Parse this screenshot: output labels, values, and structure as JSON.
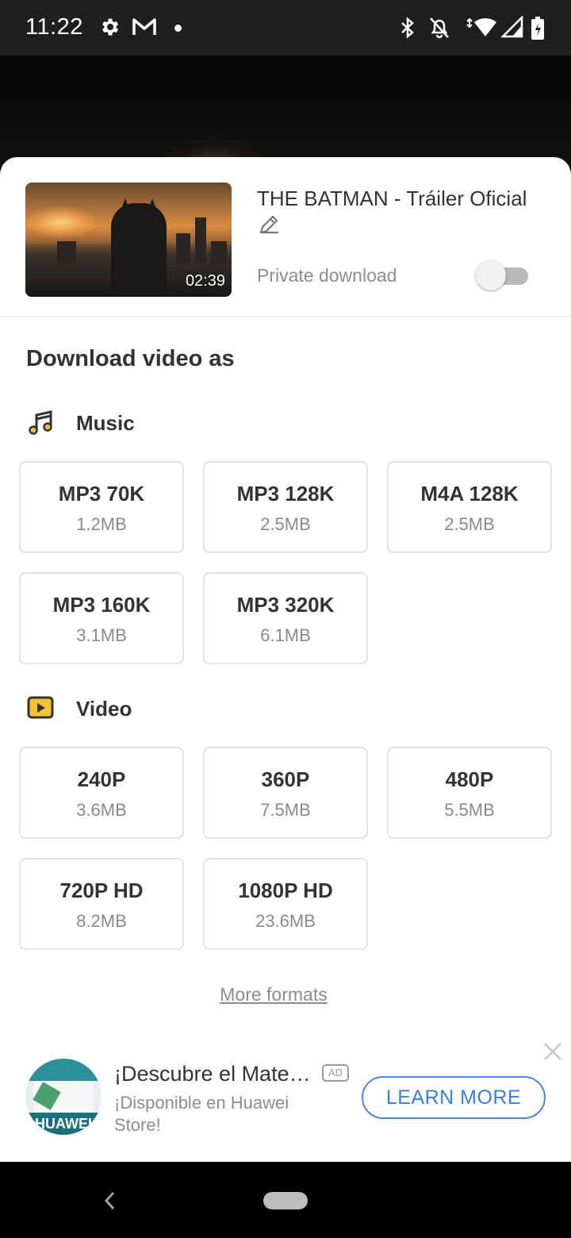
{
  "status_bar": {
    "time": "11:22",
    "icons": [
      "gear-icon",
      "gmail-icon",
      "notification-dot",
      "bluetooth-icon",
      "bell-off-icon",
      "wifi-icon",
      "signal-icon",
      "battery-icon"
    ]
  },
  "header": {
    "video_title": "THE BATMAN - Tráiler Oficial",
    "duration": "02:39",
    "private_download_label": "Private download",
    "private_download_enabled": false
  },
  "download": {
    "heading": "Download video as",
    "music": {
      "label": "Music",
      "options": [
        {
          "name": "MP3 70K",
          "size": "1.2MB"
        },
        {
          "name": "MP3 128K",
          "size": "2.5MB"
        },
        {
          "name": "M4A 128K",
          "size": "2.5MB"
        },
        {
          "name": "MP3 160K",
          "size": "3.1MB"
        },
        {
          "name": "MP3 320K",
          "size": "6.1MB"
        }
      ]
    },
    "video": {
      "label": "Video",
      "options": [
        {
          "name": "240P",
          "size": "3.6MB"
        },
        {
          "name": "360P",
          "size": "7.5MB"
        },
        {
          "name": "480P",
          "size": "5.5MB"
        },
        {
          "name": "720P HD",
          "size": "8.2MB"
        },
        {
          "name": "1080P HD",
          "size": "23.6MB"
        }
      ]
    },
    "more_formats": "More formats"
  },
  "ad": {
    "title": "¡Descubre el Mate…",
    "badge": "AD",
    "subtitle": "¡Disponible en Huawei Store!",
    "cta": "LEARN MORE",
    "logo_text": "HUAWEI"
  },
  "colors": {
    "accent": "#3b7ddd",
    "category_icon": "#f4c430"
  }
}
